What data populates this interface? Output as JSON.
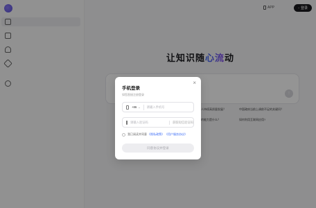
{
  "app": {
    "app_download_label": "APP",
    "login_label": "登录"
  },
  "hero": {
    "prefix": "让知识随",
    "highlight": "心流",
    "suffix": "动"
  },
  "suggestions": [
    "人持续高质量发展？",
    "中国政府当前上调前不足的关键问？",
    "的能力是什么？",
    "如何利用互联网应用?"
  ],
  "modal": {
    "title": "手机登录",
    "subtitle": "如您直接注册登录",
    "phone": {
      "country_code": "+86",
      "placeholder": "请输入手机号",
      "value": ""
    },
    "code": {
      "placeholder": "请输入验证码",
      "value": "",
      "get_code_label": "获取短信验证码"
    },
    "agreement": {
      "text": "我已阅读并同意",
      "privacy_link": "《隐私政策》",
      "user_link": "《用户服务协议》"
    },
    "submit_label": "同意协议并登录"
  },
  "colors": {
    "accent": "#3b6cf6",
    "gradient_end": "#8b4dea"
  }
}
